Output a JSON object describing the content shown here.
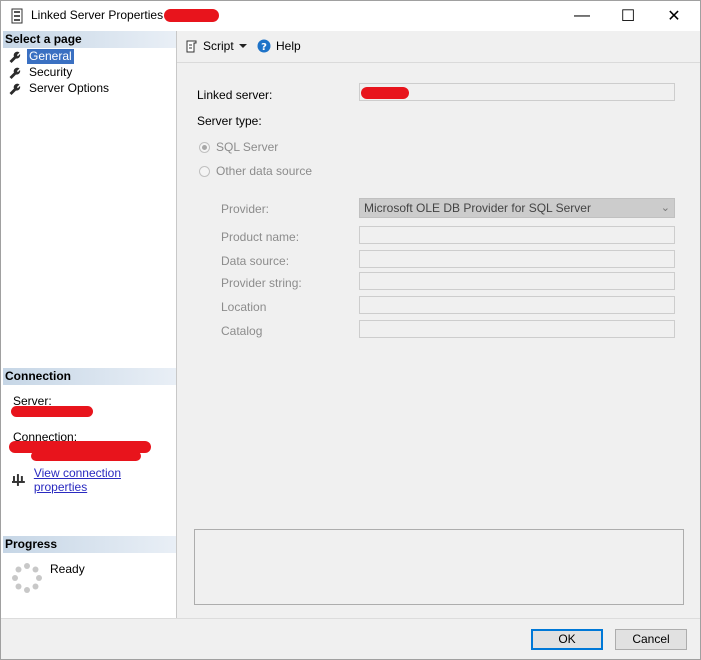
{
  "window": {
    "title": "Linked Server Properties -",
    "controls": {
      "minimize": "—",
      "maximize": "☐",
      "close": "✕"
    }
  },
  "left_panel": {
    "select_page_header": "Select a page",
    "pages": [
      {
        "label": "General",
        "selected": true,
        "icon": "wrench-icon"
      },
      {
        "label": "Security",
        "selected": false,
        "icon": "wrench-icon"
      },
      {
        "label": "Server Options",
        "selected": false,
        "icon": "wrench-icon"
      }
    ],
    "connection_header": "Connection",
    "server_label": "Server:",
    "connection_label": "Connection:",
    "view_connection_link": "View connection properties",
    "progress_header": "Progress",
    "progress_status": "Ready"
  },
  "toolbar": {
    "script_label": "Script",
    "help_label": "Help"
  },
  "form": {
    "linked_server_label": "Linked server:",
    "server_type_label": "Server type:",
    "sql_server_option": "SQL Server",
    "other_source_option": "Other data source",
    "provider_label": "Provider:",
    "provider_value": "Microsoft OLE DB Provider for SQL Server",
    "product_name_label": "Product name:",
    "data_source_label": "Data source:",
    "provider_string_label": "Provider string:",
    "location_label": "Location",
    "catalog_label": "Catalog"
  },
  "buttons": {
    "ok": "OK",
    "cancel": "Cancel"
  },
  "colors": {
    "redaction": "#e8141c",
    "selection": "#3a70c2",
    "link": "#2a2ac0",
    "default_button_border": "#0078d7"
  }
}
